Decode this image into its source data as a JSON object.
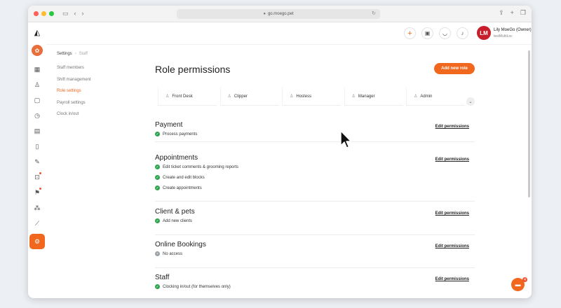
{
  "browser": {
    "url": "go.moego.pet"
  },
  "header": {
    "user_initials": "LM",
    "user_name": "Lily MoeGo (Owner)",
    "business_name": "testMultiLoc"
  },
  "settings_nav": {
    "breadcrumb_root": "Settings",
    "breadcrumb_current": "Staff",
    "items": [
      {
        "label": "Staff members"
      },
      {
        "label": "Shift management"
      },
      {
        "label": "Role settings"
      },
      {
        "label": "Payroll settings"
      },
      {
        "label": "Clock in/out"
      }
    ]
  },
  "main": {
    "title": "Role permissions",
    "add_role_label": "Add new role",
    "roles": [
      {
        "label": "Front Desk"
      },
      {
        "label": "Clipper"
      },
      {
        "label": "Hostess"
      },
      {
        "label": "Manager"
      },
      {
        "label": "Admin"
      }
    ],
    "edit_label": "Edit permissions",
    "sections": [
      {
        "title": "Payment",
        "permissions": [
          "Process payments"
        ]
      },
      {
        "title": "Appointments",
        "permissions": [
          "Edit ticket comments & grooming reports",
          "Create and edit blocks",
          "Create appointments"
        ]
      },
      {
        "title": "Client & pets",
        "permissions": [
          "Add new clients"
        ]
      },
      {
        "title": "Online Bookings",
        "permissions": [
          "No access"
        ]
      },
      {
        "title": "Staff",
        "permissions": [
          "Clocking in/out (for themselves only)"
        ]
      }
    ]
  },
  "chat": {
    "badge_count": "4"
  },
  "colors": {
    "accent": "#f0671d",
    "check": "#2ea44f",
    "avatar": "#c81d2a"
  }
}
